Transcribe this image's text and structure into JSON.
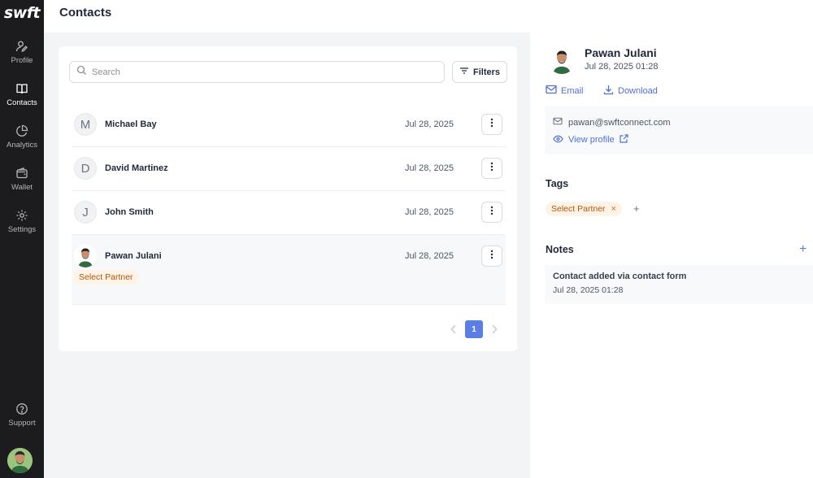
{
  "app": {
    "logo": "swft",
    "page_title": "Contacts"
  },
  "sidebar": {
    "items": [
      {
        "label": "Profile",
        "icon": "profile-icon"
      },
      {
        "label": "Contacts",
        "icon": "book-icon",
        "active": true
      },
      {
        "label": "Analytics",
        "icon": "pie-chart-icon"
      },
      {
        "label": "Wallet",
        "icon": "wallet-icon"
      },
      {
        "label": "Settings",
        "icon": "gear-icon"
      }
    ],
    "support_label": "Support"
  },
  "search": {
    "placeholder": "Search",
    "value": ""
  },
  "filters_label": "Filters",
  "contacts": [
    {
      "initial": "M",
      "name": "Michael Bay",
      "date": "Jul 28, 2025"
    },
    {
      "initial": "D",
      "name": "David Martinez",
      "date": "Jul 28, 2025"
    },
    {
      "initial": "J",
      "name": "John Smith",
      "date": "Jul 28, 2025"
    },
    {
      "initial": "",
      "name": "Pawan Julani",
      "date": "Jul 28, 2025",
      "tag": "Select Partner",
      "selected": true
    }
  ],
  "pagination": {
    "current": "1"
  },
  "detail": {
    "name": "Pawan Julani",
    "date": "Jul 28, 2025 01:28",
    "email_action": "Email",
    "download_action": "Download",
    "email": "pawan@swftconnect.com",
    "view_profile": "View profile",
    "tags_title": "Tags",
    "tag": "Select Partner",
    "tag_remove": "×",
    "tag_add": "+",
    "notes_title": "Notes",
    "notes_add": "+",
    "note_text": "Contact added via contact form",
    "note_date": "Jul 28, 2025 01:28"
  },
  "colors": {
    "sidebar": "#1c1c1e",
    "accent": "#5b7ee5",
    "link": "#4f6fd6",
    "tag_bg": "#fdf3e6",
    "tag_text": "#b45309"
  }
}
